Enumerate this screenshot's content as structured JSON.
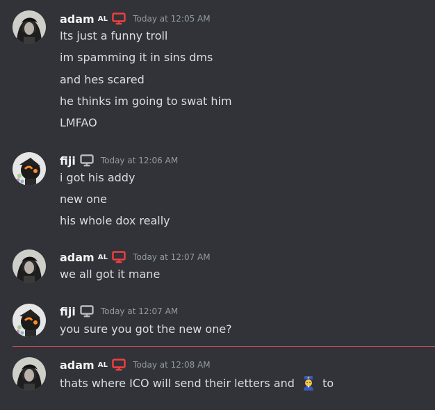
{
  "accent_colors": {
    "desktop_icon_red": "#f23f42",
    "desktop_icon_gray": "#b5bac1",
    "new_messages_line": "#c94c55"
  },
  "messages": [
    {
      "author": "adam",
      "tag": "AL",
      "device_icon": "desktop-icon",
      "timestamp": "Today at 12:05 AM",
      "lines": [
        "Its just a funny troll",
        "im spamming it in sins dms",
        "and hes scared",
        "he thinks im going to swat him",
        "LMFAO"
      ]
    },
    {
      "author": "fiji",
      "tag": "",
      "device_icon": "desktop-icon",
      "timestamp": "Today at 12:06 AM",
      "lines": [
        "i got his addy",
        "new one",
        "his whole dox really"
      ]
    },
    {
      "author": "adam",
      "tag": "AL",
      "device_icon": "desktop-icon",
      "timestamp": "Today at 12:07 AM",
      "lines": [
        "we all got it mane"
      ]
    },
    {
      "author": "fiji",
      "tag": "",
      "device_icon": "desktop-icon",
      "timestamp": "Today at 12:07 AM",
      "lines": [
        "you sure you got the new one?"
      ]
    },
    {
      "author": "adam",
      "tag": "AL",
      "device_icon": "desktop-icon",
      "timestamp": "Today at 12:08 AM",
      "lines": [
        "thats where ICO will send their letters and"
      ],
      "trailing_emoji": "police-officer-emoji",
      "trailing_text": "to"
    }
  ]
}
